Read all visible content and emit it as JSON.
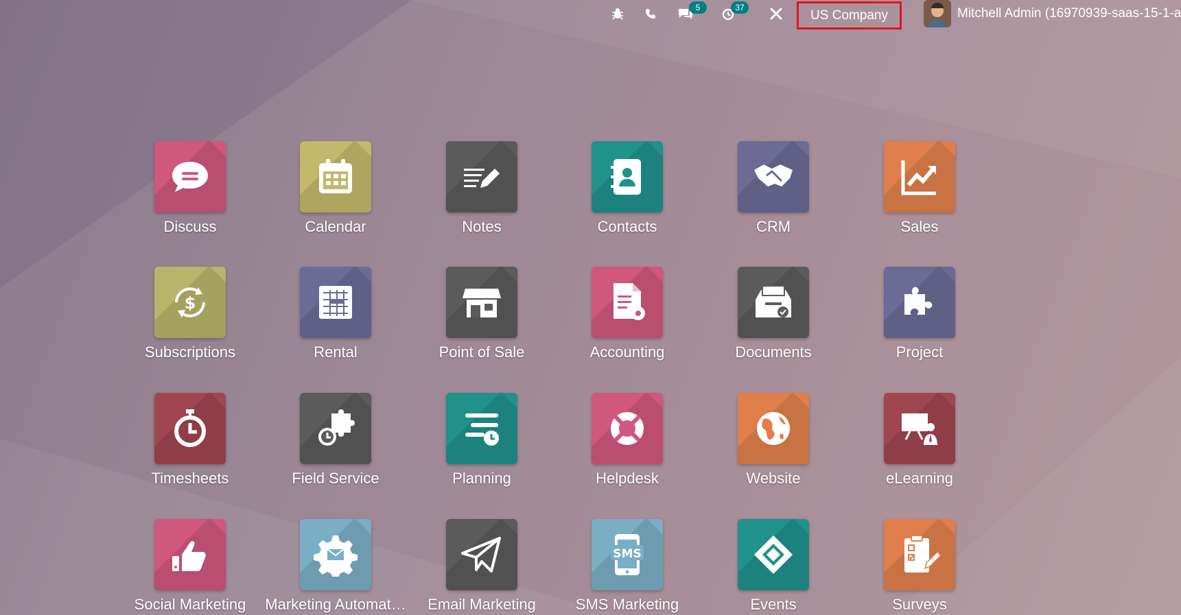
{
  "topbar": {
    "chat_badge": "5",
    "activity_badge": "37",
    "company": "US Company",
    "user": "Mitchell Admin (16970939-saas-15-1-a"
  },
  "apps": [
    {
      "name": "Discuss",
      "color": "#d0577d",
      "icon": "discuss-icon"
    },
    {
      "name": "Calendar",
      "color": "#c3b86b",
      "icon": "calendar-icon"
    },
    {
      "name": "Notes",
      "color": "#5b5b5b",
      "icon": "notes-icon"
    },
    {
      "name": "Contacts",
      "color": "#21918c",
      "icon": "contacts-icon"
    },
    {
      "name": "CRM",
      "color": "#6b6b96",
      "icon": "crm-icon"
    },
    {
      "name": "Sales",
      "color": "#e07f4b",
      "icon": "sales-icon"
    },
    {
      "name": "Subscriptions",
      "color": "#b8b46a",
      "icon": "subscriptions-icon"
    },
    {
      "name": "Rental",
      "color": "#6b6b96",
      "icon": "rental-icon"
    },
    {
      "name": "Point of Sale",
      "color": "#5b5b5b",
      "icon": "point-of-sale-icon"
    },
    {
      "name": "Accounting",
      "color": "#d0577d",
      "icon": "accounting-icon"
    },
    {
      "name": "Documents",
      "color": "#5b5b5b",
      "icon": "documents-icon"
    },
    {
      "name": "Project",
      "color": "#6b6b96",
      "icon": "project-icon"
    },
    {
      "name": "Timesheets",
      "color": "#a04650",
      "icon": "timesheets-icon"
    },
    {
      "name": "Field Service",
      "color": "#5b5b5b",
      "icon": "field-service-icon"
    },
    {
      "name": "Planning",
      "color": "#21918c",
      "icon": "planning-icon"
    },
    {
      "name": "Helpdesk",
      "color": "#d0577d",
      "icon": "helpdesk-icon"
    },
    {
      "name": "Website",
      "color": "#e07f4b",
      "icon": "website-icon"
    },
    {
      "name": "eLearning",
      "color": "#a04650",
      "icon": "elearning-icon"
    },
    {
      "name": "Social Marketing",
      "color": "#d0577d",
      "icon": "social-marketing-icon"
    },
    {
      "name": "Marketing Automat…",
      "color": "#7aaec4",
      "icon": "marketing-automation-icon"
    },
    {
      "name": "Email Marketing",
      "color": "#5b5b5b",
      "icon": "email-marketing-icon"
    },
    {
      "name": "SMS Marketing",
      "color": "#7aaec4",
      "icon": "sms-marketing-icon"
    },
    {
      "name": "Events",
      "color": "#21918c",
      "icon": "events-icon"
    },
    {
      "name": "Surveys",
      "color": "#e07f4b",
      "icon": "surveys-icon"
    }
  ]
}
